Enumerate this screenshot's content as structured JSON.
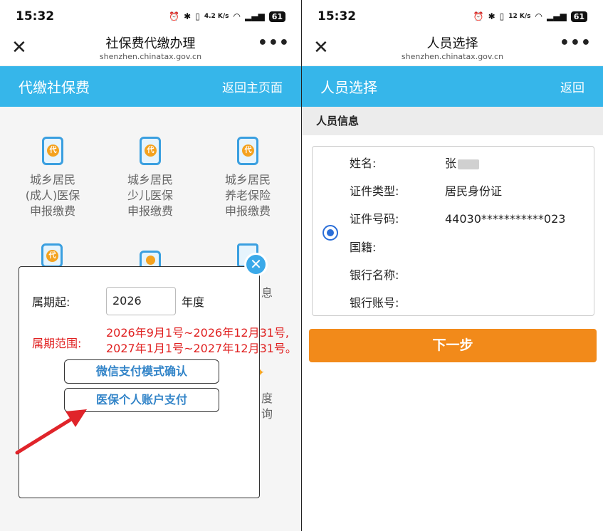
{
  "left": {
    "status": {
      "time": "15:32",
      "net_speed": "4.2 K/s",
      "battery": "61"
    },
    "nav": {
      "title": "社保费代缴办理",
      "subtitle": "shenzhen.chinatax.gov.cn",
      "more": "•••"
    },
    "header": {
      "title": "代缴社保费",
      "back_link": "返回主页面"
    },
    "grid": [
      {
        "line1": "城乡居民",
        "line2": "(成人)医保",
        "line3": "申报缴费",
        "badge": "代"
      },
      {
        "line1": "城乡居民",
        "line2": "少儿医保",
        "line3": "申报缴费",
        "badge": "代"
      },
      {
        "line1": "城乡居民",
        "line2": "养老保险",
        "line3": "申报缴费",
        "badge": "代"
      }
    ],
    "hidden_fragments": {
      "item6_partial": "息",
      "item5_partial_1": "度",
      "item5_partial_2": "询"
    },
    "modal": {
      "period_label": "属期起:",
      "year_value": "2026",
      "year_unit": "年度",
      "range_label": "属期范围:",
      "range_line1": "2026年9月1号~2026年12月31号,",
      "range_line2": "2027年1月1号~2027年12月31号。",
      "wechat_button": "微信支付模式确认",
      "medical_button": "医保个人账户支付"
    },
    "colors": {
      "header_blue": "#36b6ea",
      "arrow_red": "#e0242a",
      "range_red": "#e02020",
      "button_text_blue": "#3284c8"
    }
  },
  "right": {
    "status": {
      "time": "15:32",
      "net_speed": "12 K/s",
      "battery": "61"
    },
    "nav": {
      "title": "人员选择",
      "subtitle": "shenzhen.chinatax.gov.cn",
      "more": "•••"
    },
    "header": {
      "title": "人员选择",
      "back_link": "返回"
    },
    "section_title": "人员信息",
    "person": [
      {
        "key": "姓名:",
        "value": "张"
      },
      {
        "key": "证件类型:",
        "value": "居民身份证"
      },
      {
        "key": "证件号码:",
        "value": "44030***********023"
      },
      {
        "key": "国籍:",
        "value": ""
      },
      {
        "key": "银行名称:",
        "value": ""
      },
      {
        "key": "银行账号:",
        "value": ""
      }
    ],
    "next_button": "下一步",
    "colors": {
      "next_orange": "#f28a1a",
      "radio_blue": "#2a6ed8"
    }
  }
}
